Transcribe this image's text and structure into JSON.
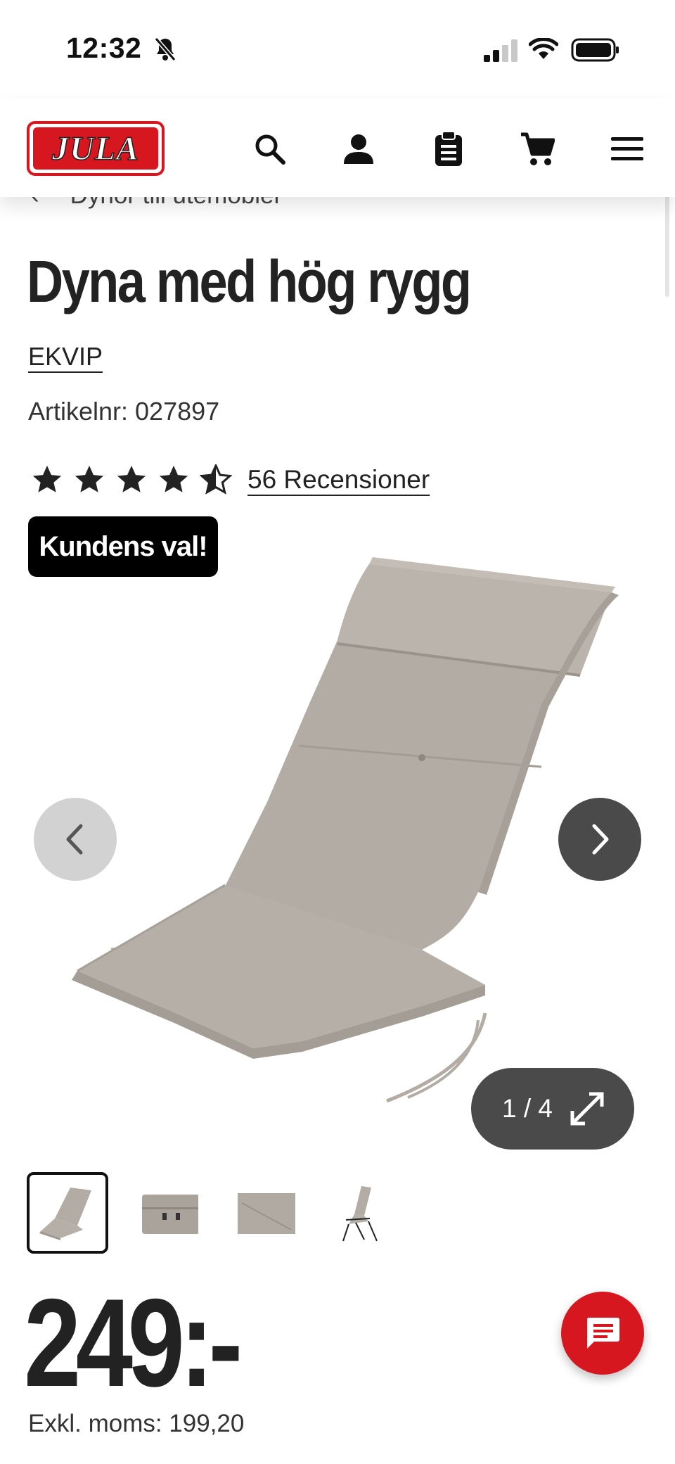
{
  "status_bar": {
    "time": "12:32"
  },
  "header": {
    "logo_text": "JULA",
    "icons": [
      "search-icon",
      "user-icon",
      "clipboard-icon",
      "cart-icon",
      "menu-icon"
    ]
  },
  "breadcrumb": {
    "label": "Dynor till utemöbler"
  },
  "product": {
    "title": "Dyna med hög rygg",
    "brand": "EKVIP",
    "article_number": "Artikelnr: 027897",
    "rating": 4.5,
    "rating_max": 5,
    "reviews_label": "56 Recensioner",
    "badge": "Kundens val!",
    "price": "249:-",
    "price_ex_vat": "Exkl. moms: 199,20"
  },
  "gallery": {
    "counter": "1 / 4",
    "current": 1,
    "total": 4,
    "thumbnails": [
      "chair-cushion",
      "cushion-back",
      "fabric-detail",
      "chair-with-cushion"
    ]
  },
  "colors": {
    "brand_red": "#d7171f",
    "badge_bg": "#000000",
    "cushion": "#b3aca5",
    "dark_button": "#4a4a4a"
  }
}
